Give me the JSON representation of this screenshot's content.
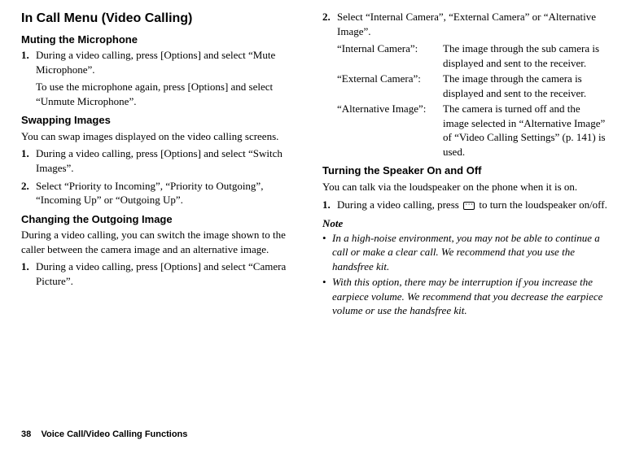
{
  "left": {
    "section_title": "In Call Menu (Video Calling)",
    "muting_heading": "Muting the Microphone",
    "muting_step1_num": "1.",
    "muting_step1": "During a video calling, press [Options] and select “Mute Microphone”.",
    "muting_note": "To use the microphone again, press [Options] and select “Unmute Microphone”.",
    "swapping_heading": "Swapping Images",
    "swapping_intro": "You can swap images displayed on the video calling screens.",
    "swapping_step1_num": "1.",
    "swapping_step1": "During a video calling, press [Options] and select “Switch Images”.",
    "swapping_step2_num": "2.",
    "swapping_step2": "Select “Priority to Incoming”, “Priority to Outgoing”, “Incoming Up” or “Outgoing Up”.",
    "changing_heading": "Changing the Outgoing Image",
    "changing_intro": "During a video calling, you can switch the image shown to the caller between the camera image and an alternative image.",
    "changing_step1_num": "1.",
    "changing_step1": "During a video calling, press [Options] and select “Camera Picture”."
  },
  "right": {
    "step2_num": "2.",
    "step2": "Select “Internal Camera”, “External Camera” or “Alternative Image”.",
    "defs": [
      {
        "term": "“Internal Camera”:",
        "desc": "The image through the sub camera is displayed and sent to the receiver."
      },
      {
        "term": "“External Camera”:",
        "desc": "The image through the camera is displayed and sent to the receiver."
      },
      {
        "term": "“Alternative Image”:",
        "desc": "The camera is turned off and the image selected in “Alternative Image” of “Video Calling Settings” (p. 141) is used."
      }
    ],
    "speaker_heading": "Turning the Speaker On and Off",
    "speaker_intro": "You can talk via the loudspeaker on the phone when it is on.",
    "speaker_step1_num": "1.",
    "speaker_step1_a": "During a video calling, press ",
    "speaker_step1_b": " to turn the loudspeaker on/off.",
    "note_label": "Note",
    "note1": "In a high-noise environment, you may not be able to continue a call or make a clear call. We recommend that you use the handsfree kit.",
    "note2": "With this option, there may be interruption if you increase the earpiece volume. We recommend that you decrease the earpiece volume or use the handsfree kit."
  },
  "footer": {
    "page": "38",
    "title": "Voice Call/Video Calling Functions"
  }
}
